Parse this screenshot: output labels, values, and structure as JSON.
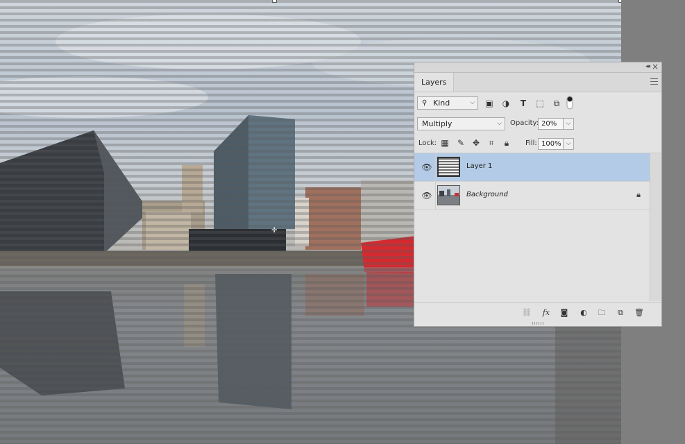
{
  "panel": {
    "tab_label": "Layers",
    "filter": {
      "kind_label": "Kind",
      "kind_icon": "search-icon"
    },
    "blend": {
      "mode": "Multiply",
      "opacity_label": "Opacity:",
      "opacity_value": "20%"
    },
    "lock": {
      "label": "Lock:",
      "fill_label": "Fill:",
      "fill_value": "100%"
    },
    "layers": [
      {
        "name": "Layer 1",
        "selected": true,
        "visible": true,
        "locked": false
      },
      {
        "name": "Background",
        "selected": false,
        "visible": true,
        "locked": true
      }
    ],
    "selection_color": "#b3cbe6"
  },
  "icons": [
    "link-icon",
    "fx-icon",
    "mask-icon",
    "adjustment-icon",
    "folder-icon",
    "new-layer-icon",
    "trash-icon",
    "eye-icon",
    "lock-icon"
  ]
}
